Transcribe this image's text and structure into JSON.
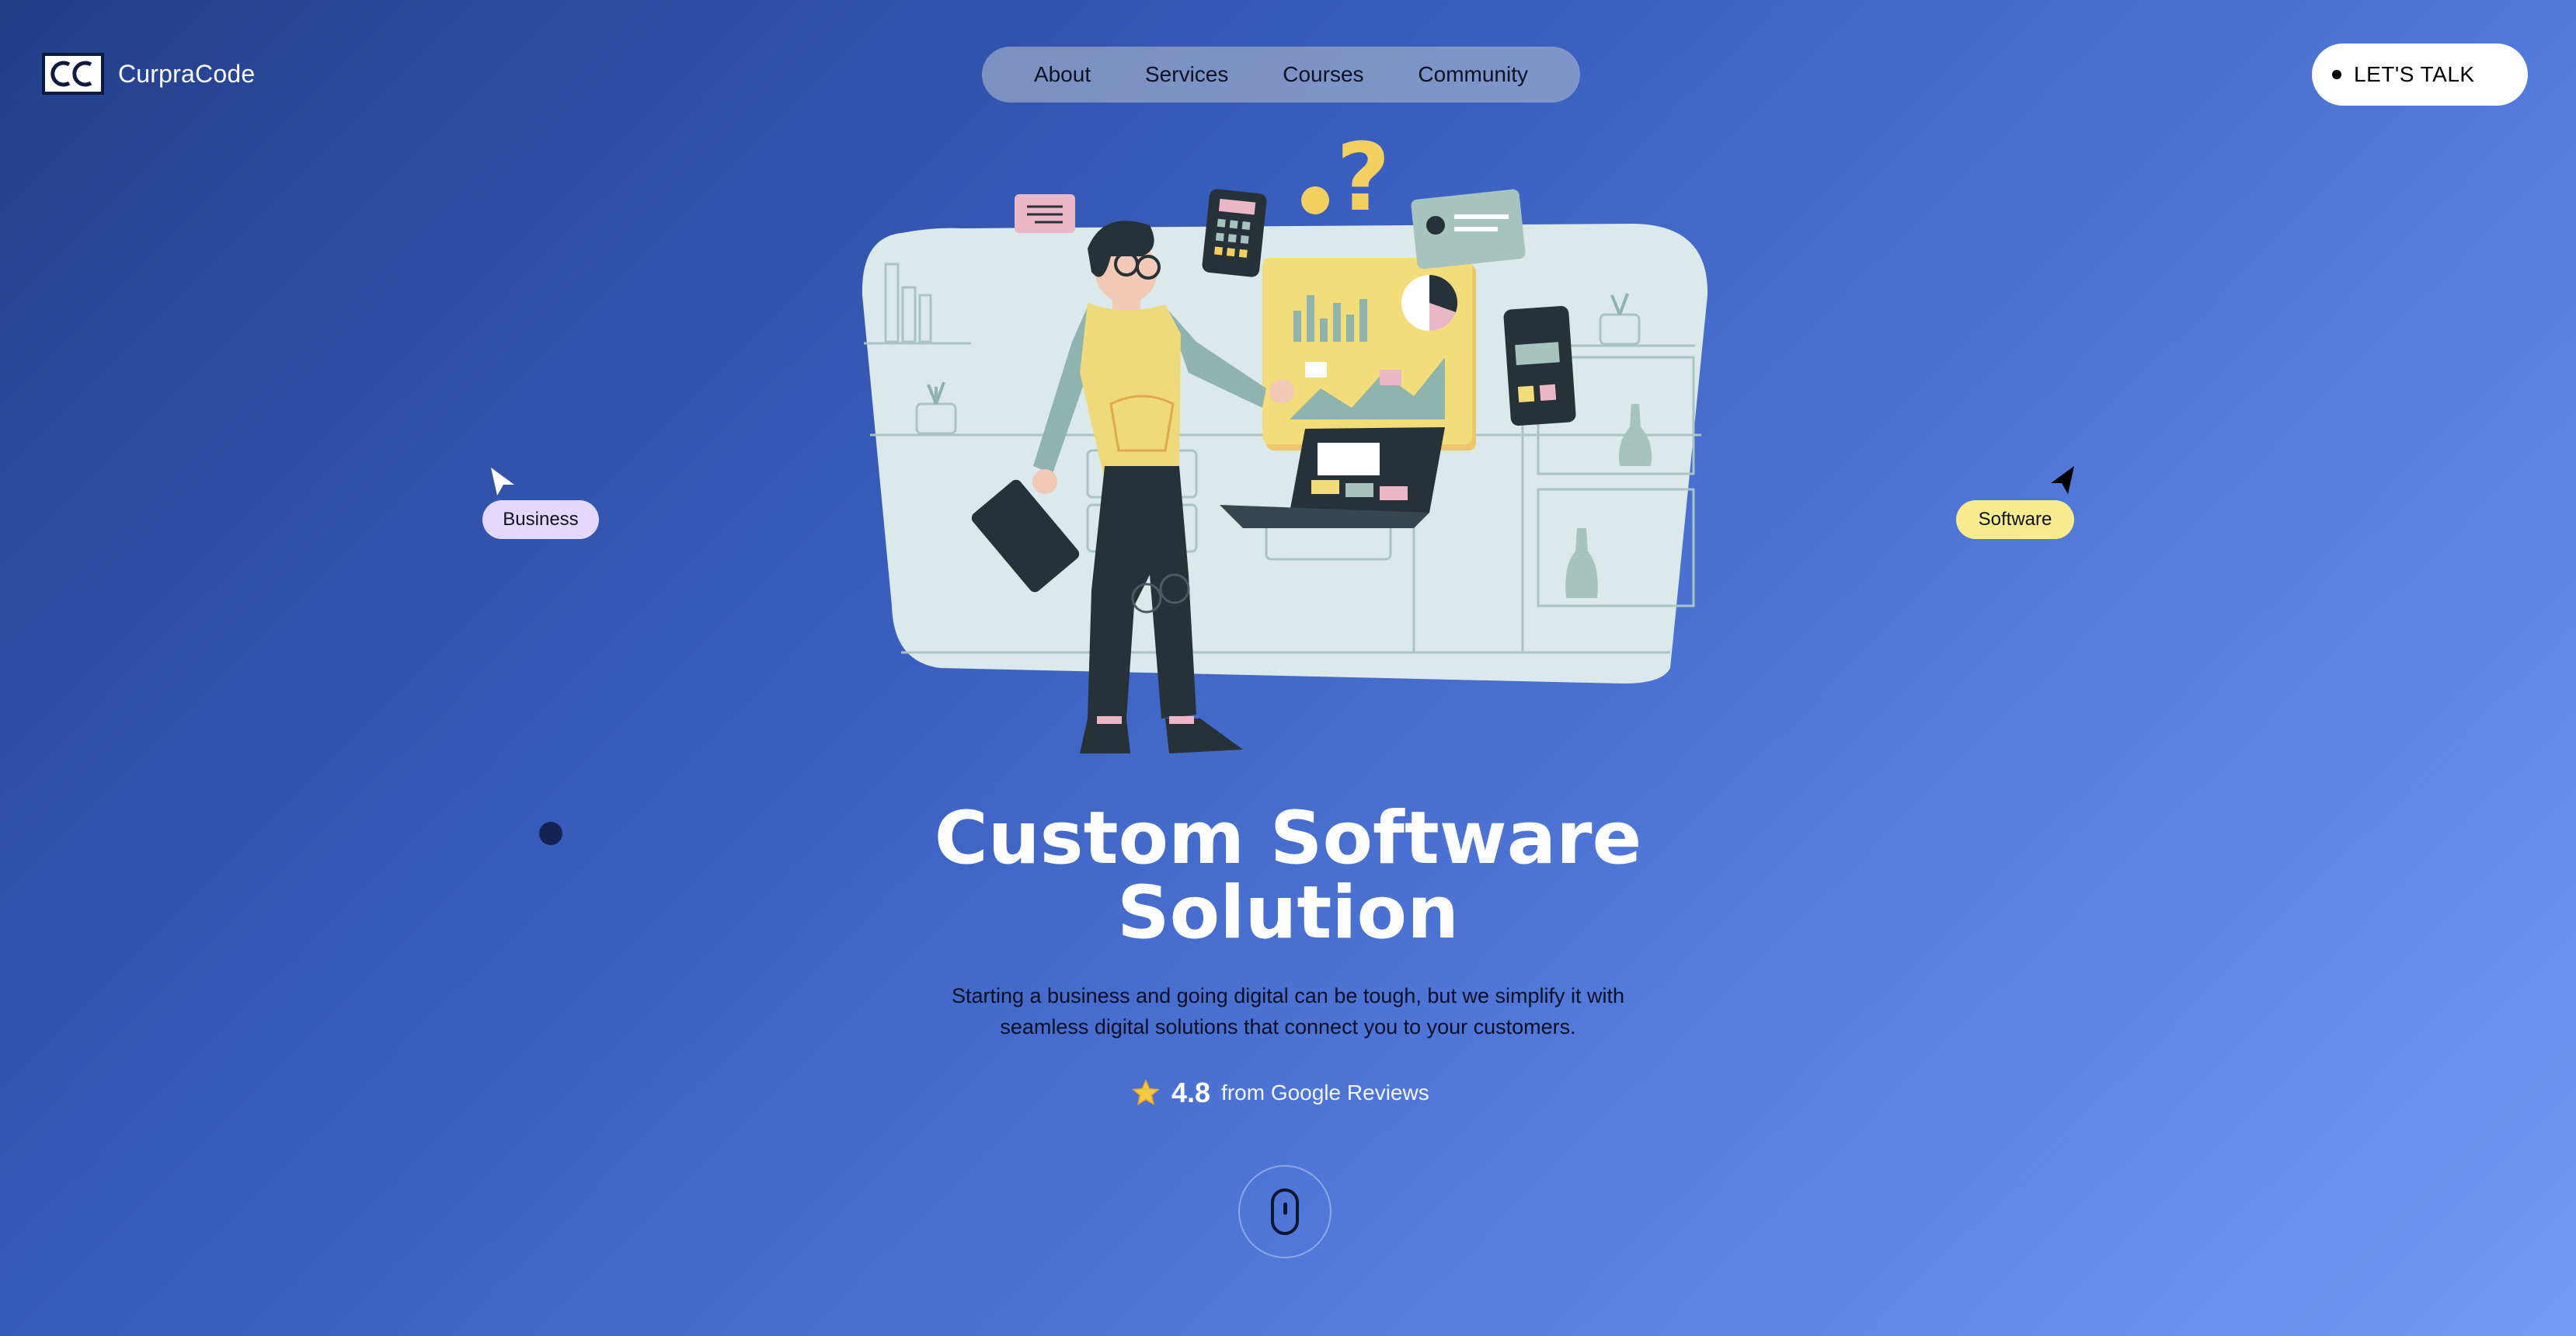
{
  "brand": {
    "name": "CurpraCode",
    "logo_icon": "cc-logo-icon"
  },
  "nav": {
    "items": [
      "About",
      "Services",
      "Courses",
      "Community"
    ]
  },
  "cta": {
    "label": "LET'S TALK"
  },
  "tags": {
    "left": "Business",
    "right": "Software"
  },
  "hero": {
    "title_line1": "Custom Software",
    "title_line2": "Solution",
    "subtitle_line1": "Starting a business and going digital can be tough, but we simplify it with",
    "subtitle_line2": "seamless digital solutions that connect you to your customers.",
    "illustration": "person-with-dashboard-illustration"
  },
  "rating": {
    "icon": "star-icon",
    "value": "4.8",
    "label": "from Google Reviews"
  },
  "scroll": {
    "icon": "mouse-scroll-icon"
  },
  "colors": {
    "bg_start": "#233f8a",
    "bg_end": "#729bf2",
    "tag_business": "#e3d7fa",
    "tag_software": "#f6ec8f",
    "nav_bg": "#aab4cd",
    "cta_bg": "#ffffff"
  }
}
